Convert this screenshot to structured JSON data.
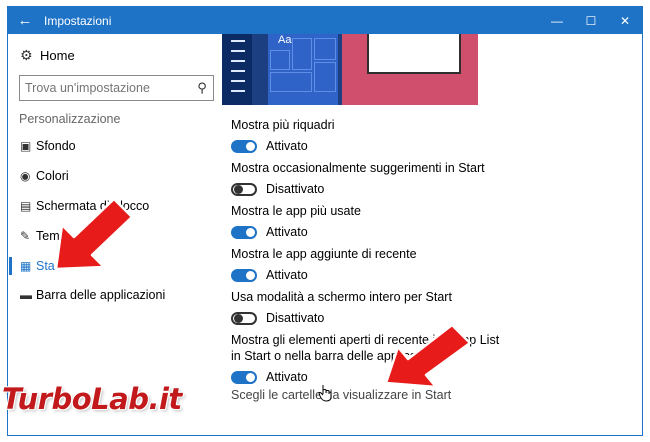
{
  "window": {
    "title": "Impostazioni",
    "accent": "#1e73c7"
  },
  "titlebar": {
    "back": "←",
    "minimize": "—",
    "maximize": "☐",
    "close": "✕"
  },
  "sidebar": {
    "home_label": "Home",
    "search_placeholder": "Trova un'impostazione",
    "section_label": "Personalizzazione",
    "items": [
      {
        "label": "Sfondo",
        "icon": "image-icon"
      },
      {
        "label": "Colori",
        "icon": "palette-icon"
      },
      {
        "label": "Schermata di blocco",
        "icon": "lock-screen-icon"
      },
      {
        "label": "Temi",
        "icon": "brush-icon"
      },
      {
        "label": "Start",
        "icon": "start-icon",
        "active": true
      },
      {
        "label": "Barra delle applicazioni",
        "icon": "taskbar-icon"
      }
    ]
  },
  "preview": {
    "tile_text": "Aa"
  },
  "settings": [
    {
      "label": "Mostra più riquadri",
      "state": "Attivato",
      "on": true
    },
    {
      "label": "Mostra occasionalmente suggerimenti in Start",
      "state": "Disattivato",
      "on": false
    },
    {
      "label": "Mostra le app più usate",
      "state": "Attivato",
      "on": true
    },
    {
      "label": "Mostra le app aggiunte di recente",
      "state": "Attivato",
      "on": true
    },
    {
      "label": "Usa modalità a schermo intero per Start",
      "state": "Disattivato",
      "on": false
    },
    {
      "label": "Mostra gli elementi aperti di recente in Jump List in Start o nella barra delle applicazioni",
      "state": "Attivato",
      "on": true
    }
  ],
  "link": "Scegli le cartelle da visualizzare in Start",
  "watermark": "TurboLab.it",
  "arrow_color": "#e81b1b"
}
